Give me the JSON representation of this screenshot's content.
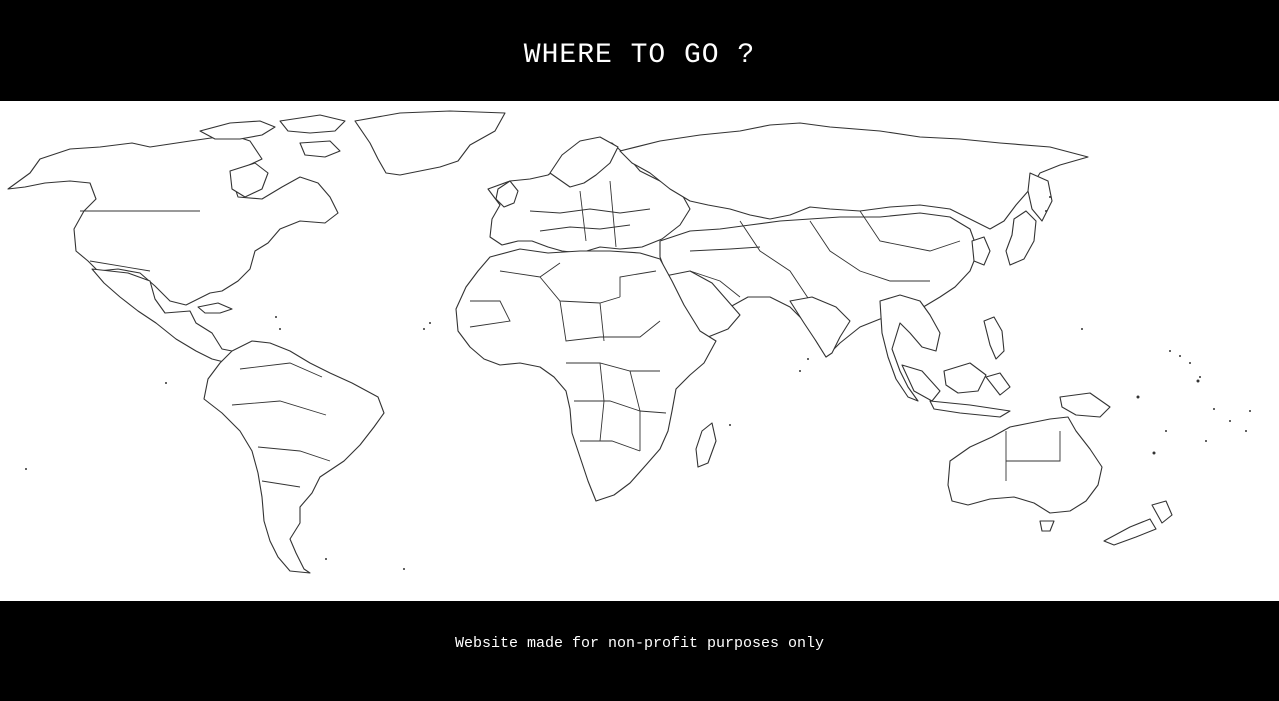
{
  "header": {
    "title": "WHERE TO GO ?"
  },
  "map": {
    "style": "outline world map",
    "land_fill": "#ffffff",
    "outline_color": "#333333"
  },
  "footer": {
    "text": "Website made for non-profit purposes only"
  },
  "colors": {
    "bars": "#000000",
    "bar_text": "#ffffff",
    "page_background": "#ffffff"
  }
}
